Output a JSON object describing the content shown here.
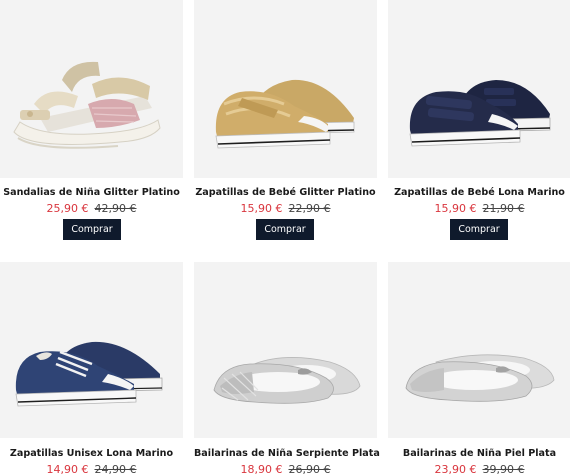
{
  "products": [
    {
      "name": "Sandalias de Niña Glitter Platino",
      "price": "25,90 €",
      "old_price": "42,90 €",
      "button": "Comprar",
      "icon": "sandal-glitter-platinum-icon"
    },
    {
      "name": "Zapatillas de Bebé Glitter Platino",
      "price": "15,90 €",
      "old_price": "22,90 €",
      "button": "Comprar",
      "icon": "sneaker-glitter-gold-icon"
    },
    {
      "name": "Zapatillas de Bebé Lona Marino",
      "price": "15,90 €",
      "old_price": "21,90 €",
      "button": "Comprar",
      "icon": "sneaker-navy-velcro-icon"
    },
    {
      "name": "Zapatillas Unisex Lona Marino",
      "price": "14,90 €",
      "old_price": "24,90 €",
      "icon": "sneaker-navy-laces-icon"
    },
    {
      "name": "Bailarinas de Niña Serpiente Plata",
      "price": "18,90 €",
      "old_price": "26,90 €",
      "icon": "ballerina-snake-silver-icon"
    },
    {
      "name": "Bailarinas de Niña Piel Plata",
      "price": "23,90 €",
      "old_price": "39,90 €",
      "icon": "ballerina-leather-silver-icon"
    }
  ],
  "colors": {
    "price": "#d9363e",
    "button_bg": "#0f1a2c",
    "image_bg": "#f3f3f3"
  }
}
